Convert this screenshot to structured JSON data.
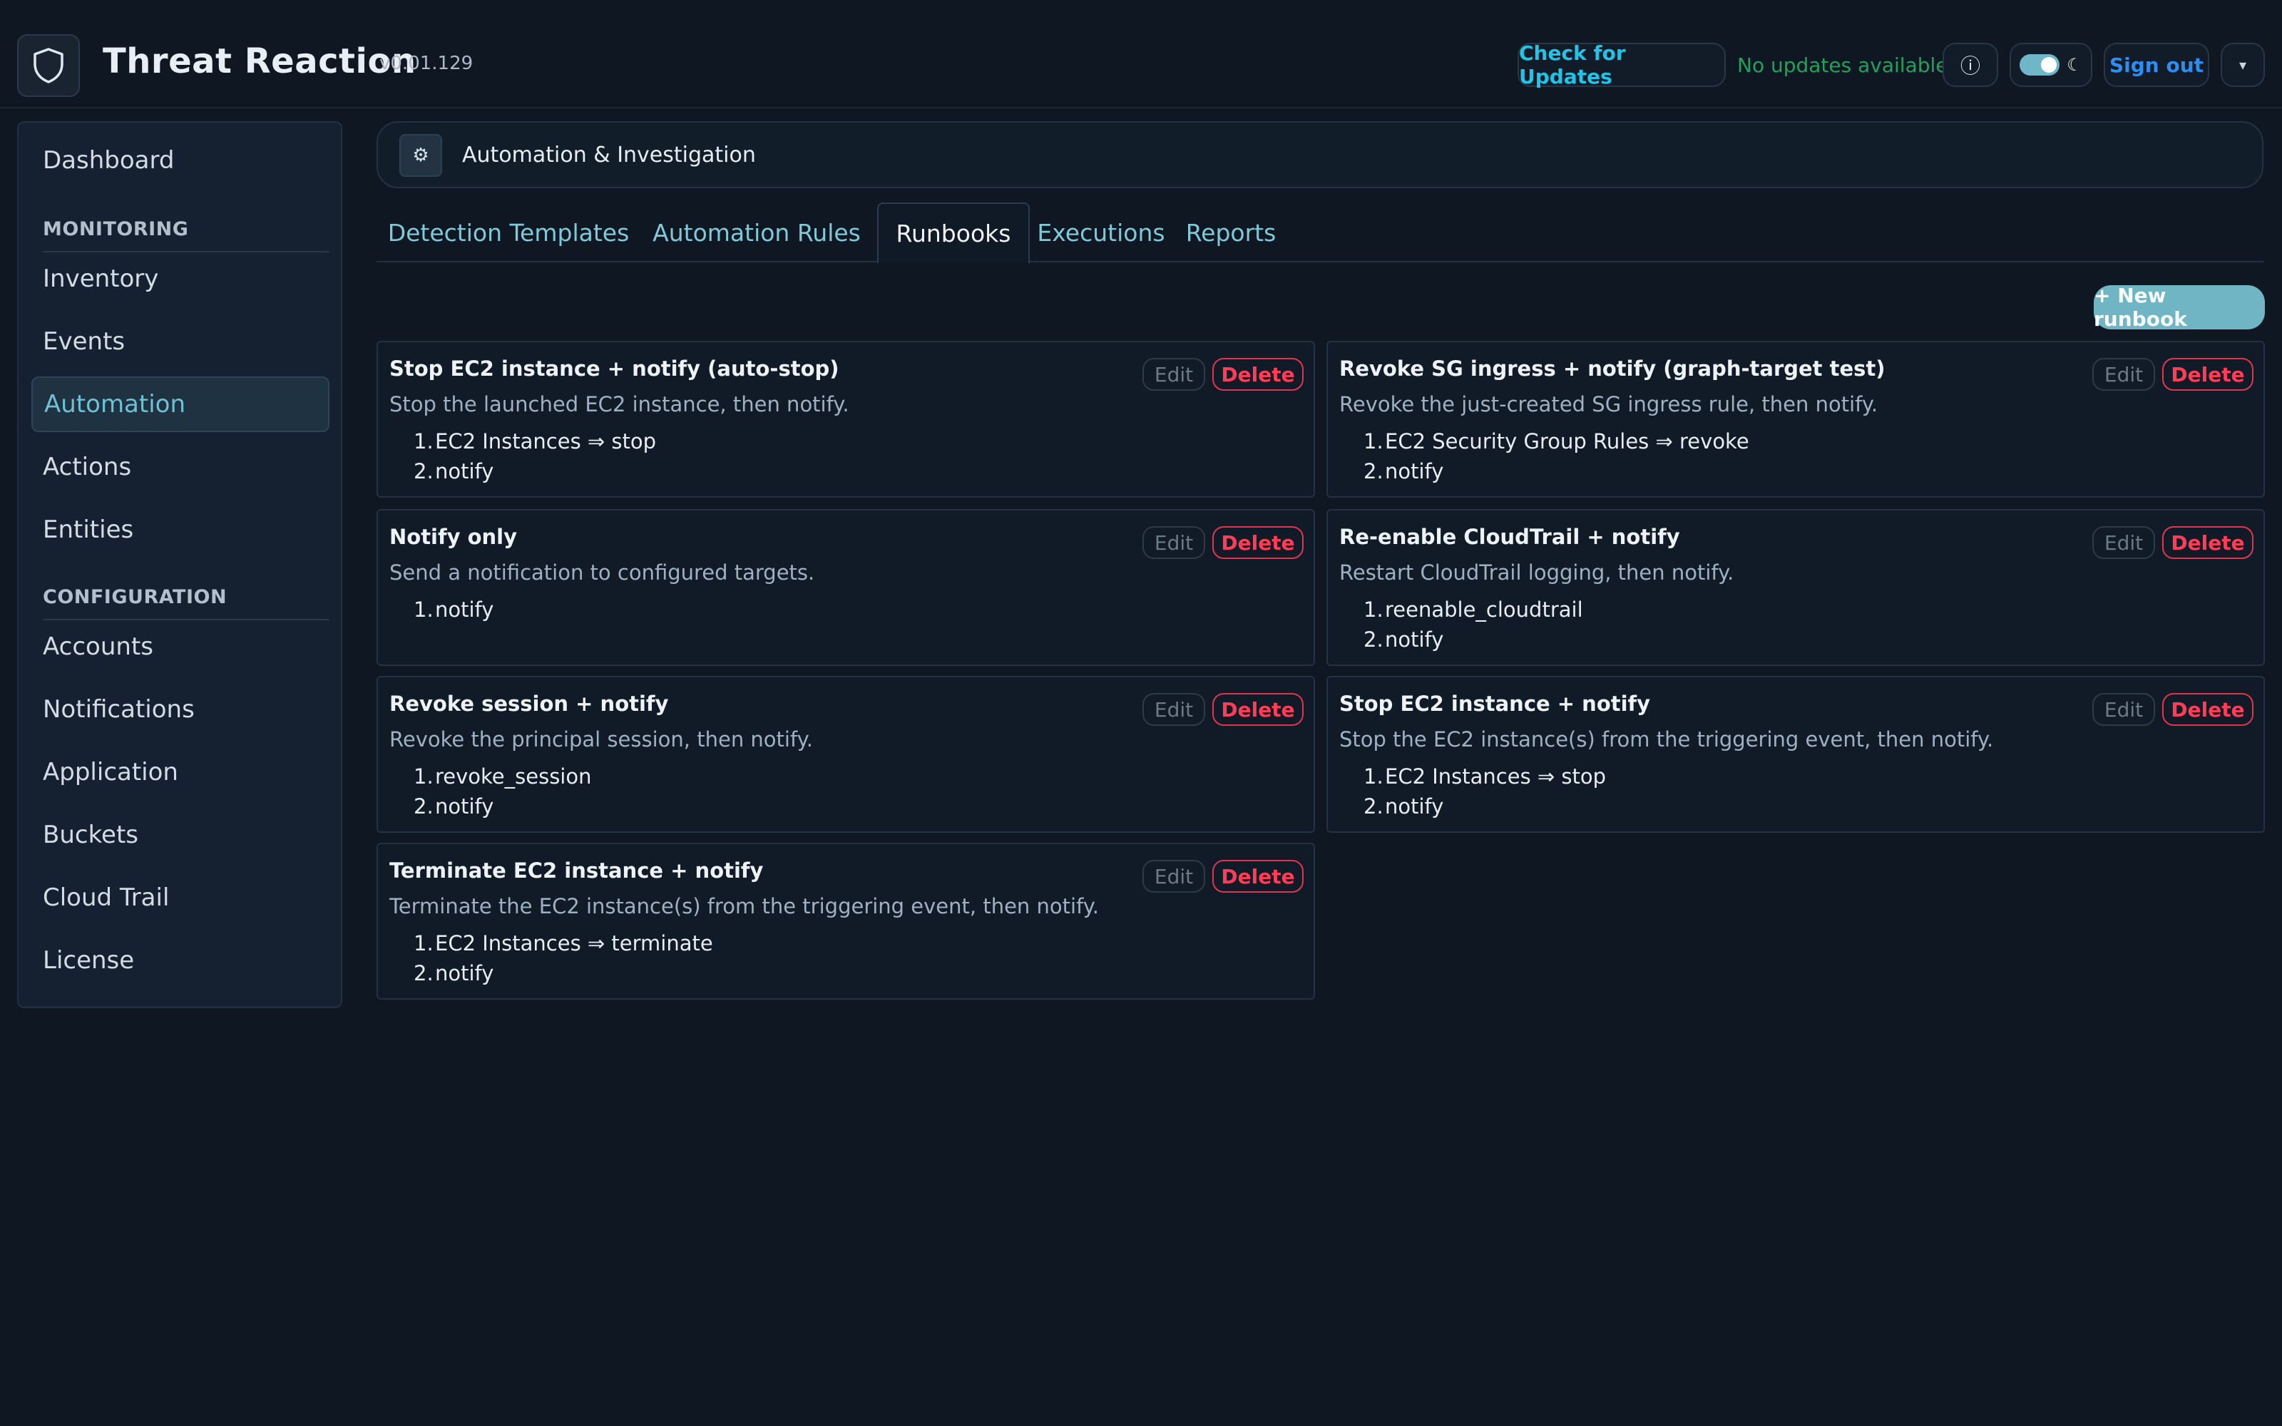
{
  "header": {
    "title": "Threat Reaction",
    "version": "v0.01.129",
    "check_updates": "Check for Updates",
    "update_status": "No updates available",
    "info_glyph": "ⓘ",
    "moon_glyph": "☾",
    "sign_out": "Sign out",
    "menu_glyph": "▾"
  },
  "sidebar": {
    "items": [
      {
        "label": "Dashboard"
      },
      {
        "label": "Inventory"
      },
      {
        "label": "Events"
      },
      {
        "label": "Automation",
        "active": true
      },
      {
        "label": "Actions"
      },
      {
        "label": "Entities"
      },
      {
        "label": "Accounts"
      },
      {
        "label": "Notifications"
      },
      {
        "label": "Application"
      },
      {
        "label": "Buckets"
      },
      {
        "label": "Cloud Trail"
      },
      {
        "label": "License"
      }
    ],
    "sections": {
      "monitoring": "MONITORING",
      "configuration": "CONFIGURATION"
    }
  },
  "section": {
    "icon_glyph": "⚙",
    "title": "Automation & Investigation"
  },
  "tabs": [
    {
      "label": "Detection Templates"
    },
    {
      "label": "Automation Rules"
    },
    {
      "label": "Runbooks",
      "active": true
    },
    {
      "label": "Executions"
    },
    {
      "label": "Reports"
    }
  ],
  "new_runbook": "+ New runbook",
  "edit_label": "Edit",
  "delete_label": "Delete",
  "runbooks": [
    {
      "title": "Stop EC2 instance + notify (auto-stop)",
      "description": "Stop the launched EC2 instance, then notify.",
      "steps": [
        {
          "num": "1.",
          "text": "EC2 Instances ⇒ stop"
        },
        {
          "num": "2.",
          "text": "notify"
        }
      ]
    },
    {
      "title": "Revoke SG ingress + notify (graph-target test)",
      "description": "Revoke the just-created SG ingress rule, then notify.",
      "steps": [
        {
          "num": "1.",
          "text": "EC2 Security Group Rules ⇒ revoke"
        },
        {
          "num": "2.",
          "text": "notify"
        }
      ]
    },
    {
      "title": "Notify only",
      "description": "Send a notification to configured targets.",
      "steps": [
        {
          "num": "1.",
          "text": "notify"
        },
        {
          "num": "",
          "text": ""
        }
      ]
    },
    {
      "title": "Re-enable CloudTrail + notify",
      "description": "Restart CloudTrail logging, then notify.",
      "steps": [
        {
          "num": "1.",
          "text": "reenable_cloudtrail"
        },
        {
          "num": "2.",
          "text": "notify"
        }
      ]
    },
    {
      "title": "Revoke session + notify",
      "description": "Revoke the principal session, then notify.",
      "steps": [
        {
          "num": "1.",
          "text": "revoke_session"
        },
        {
          "num": "2.",
          "text": "notify"
        }
      ]
    },
    {
      "title": "Stop EC2 instance + notify",
      "description": "Stop the EC2 instance(s) from the triggering event, then notify.",
      "steps": [
        {
          "num": "1.",
          "text": "EC2 Instances ⇒ stop"
        },
        {
          "num": "2.",
          "text": "notify"
        }
      ]
    },
    {
      "title": "Terminate EC2 instance + notify",
      "description": "Terminate the EC2 instance(s) from the triggering event, then notify.",
      "steps": [
        {
          "num": "1.",
          "text": "EC2 Instances ⇒ terminate"
        },
        {
          "num": "2.",
          "text": "notify"
        }
      ]
    }
  ],
  "colors": {
    "background": "#0f1723",
    "accent": "#6fb5c3",
    "link": "#22c3e6",
    "success": "#21a15a",
    "danger": "#ff3d57"
  }
}
